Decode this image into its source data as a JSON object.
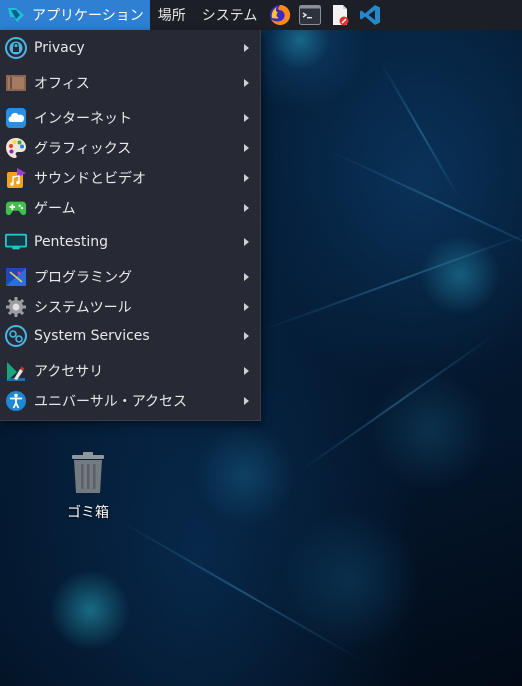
{
  "panel": {
    "applications_label": "アプリケーション",
    "places_label": "場所",
    "system_label": "システム",
    "launchers": [
      "firefox-icon",
      "terminal-icon",
      "text-editor-icon",
      "vscode-icon"
    ]
  },
  "menu": {
    "items": [
      {
        "label": "Privacy",
        "icon": "privacy-icon"
      },
      {
        "label": "オフィス",
        "icon": "office-icon"
      },
      {
        "label": "インターネット",
        "icon": "cloud-icon"
      },
      {
        "label": "グラフィックス",
        "icon": "palette-icon"
      },
      {
        "label": "サウンドとビデオ",
        "icon": "music-icon"
      },
      {
        "label": "ゲーム",
        "icon": "gamepad-icon"
      },
      {
        "label": "Pentesting",
        "icon": "monitor-icon"
      },
      {
        "label": "プログラミング",
        "icon": "code-icon"
      },
      {
        "label": "システムツール",
        "icon": "gear-icon"
      },
      {
        "label": "System Services",
        "icon": "services-icon"
      },
      {
        "label": "アクセサリ",
        "icon": "accessories-icon"
      },
      {
        "label": "ユニバーサル・アクセス",
        "icon": "accessibility-icon"
      }
    ]
  },
  "desktop": {
    "trash_label": "ゴミ箱"
  },
  "colors": {
    "panel_bg": "#1d1f27",
    "menu_bg": "#272a34",
    "active_accent": "#2f7fd3"
  }
}
